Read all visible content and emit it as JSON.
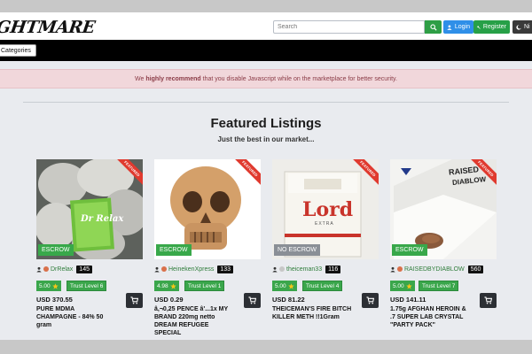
{
  "header": {
    "logo_text": "GHTMARE",
    "search": {
      "placeholder": "Search",
      "value": ""
    },
    "login_label": "Login",
    "register_label": "Register",
    "night_label": "Ni"
  },
  "nav": {
    "categories_label": "Categories"
  },
  "alert": {
    "prefix": "We",
    "strong": "highly recommend",
    "suffix": "that you disable Javascript while on the marketplace for better security."
  },
  "featured": {
    "title": "Featured Listings",
    "subtitle": "Just the best in our market..."
  },
  "listings": [
    {
      "ribbon": "FEATURED",
      "escrow": "ESCROW",
      "vendor": "DrRelax",
      "count": "145",
      "rating": "5.00",
      "trust": "Trust Level 6",
      "price": "USD 370.55",
      "title": "PURE MDMA CHAMPAGNE - 84% 50 gram",
      "image_text": "Dr Relax"
    },
    {
      "ribbon": "FEATURED",
      "escrow": "ESCROW",
      "vendor": "HeinekenXpress",
      "count": "133",
      "rating": "4.98",
      "trust": "Trust Level 1",
      "price": "USD 0.29",
      "title": "â,¬0,25 PENCE â'...1x MY BRAND 220mg netto DREAM REFUGEE SPECIAL"
    },
    {
      "ribbon": "FEATURED",
      "escrow": "NO ESCROW",
      "vendor": "theiceman33",
      "count": "116",
      "rating": "5.00",
      "trust": "Trust Level 4",
      "price": "USD 81.22",
      "title": "THEICEMAN'S FIRE BITCH KILLER METH !!1Gram",
      "image_text": "Lord",
      "image_text2": "EXTRA"
    },
    {
      "ribbon": "FEATURED",
      "escrow": "ESCROW",
      "vendor": "RAISEDBYDIABLOW",
      "count": "560",
      "rating": "5.00",
      "trust": "Trust Level 7",
      "price": "USD 141.11",
      "title": "1.75g AFGHAN HEROIN & .7 SUPER LAB CRYSTAL \"PARTY PACK\"",
      "image_text": "RAISED",
      "image_text2": "DIABLOW"
    }
  ],
  "colors": {
    "green": "#38a84a",
    "blue": "#2f8fe8",
    "red": "#e03a2f",
    "alert_bg": "#f1d7db",
    "nav": "#000000"
  }
}
